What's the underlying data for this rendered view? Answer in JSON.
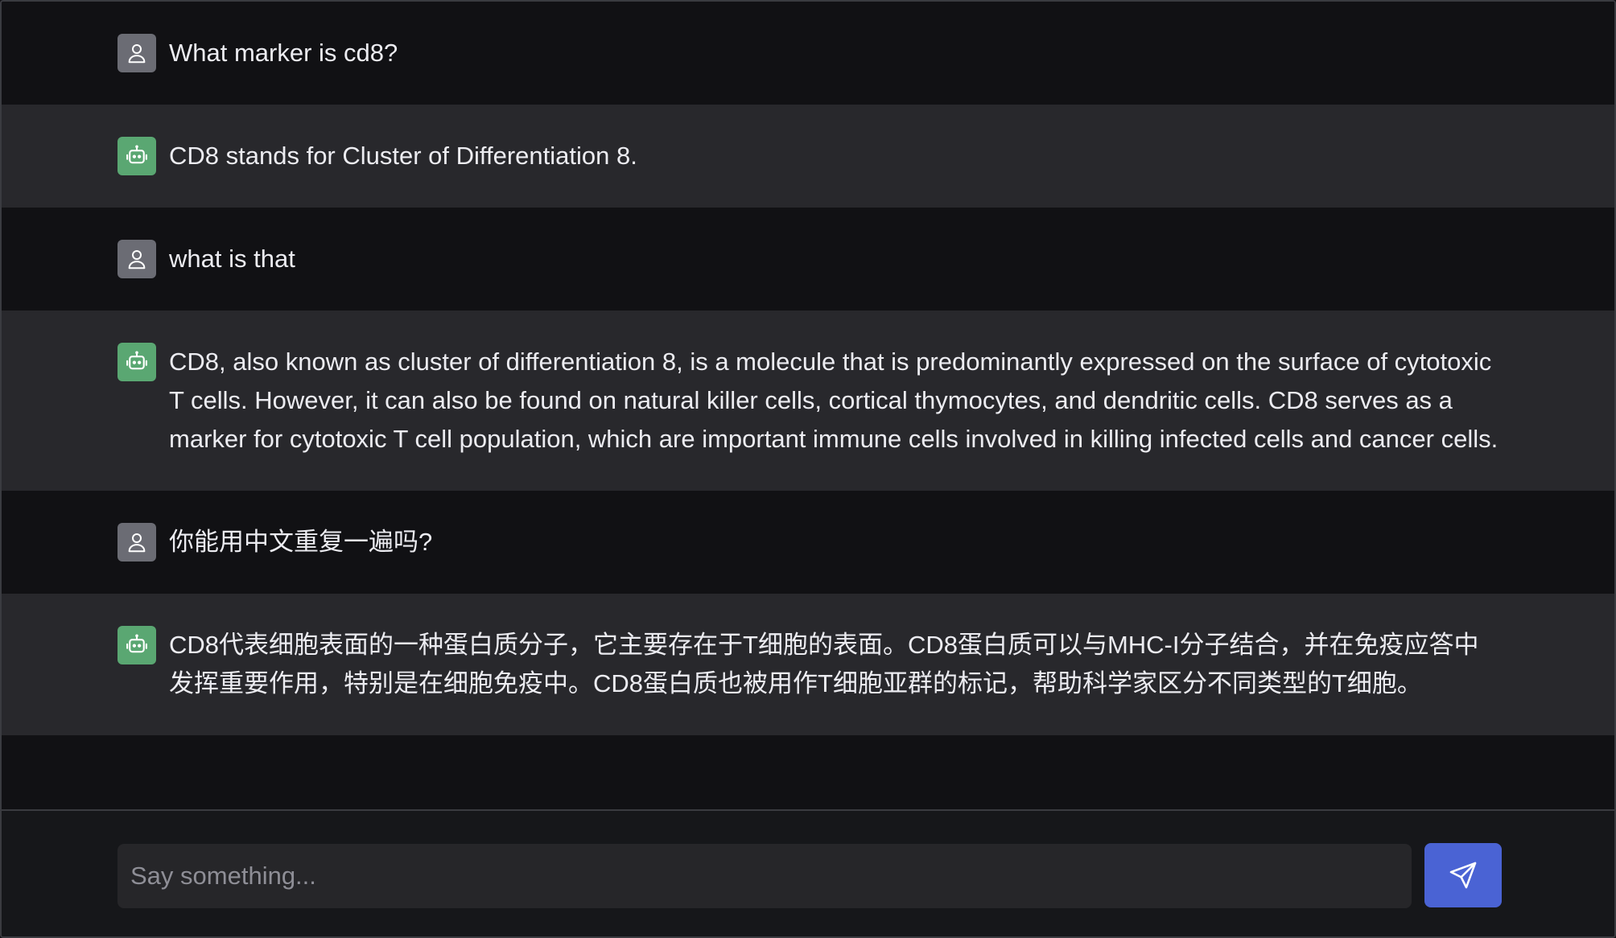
{
  "messages": [
    {
      "role": "user",
      "text": "What marker is cd8?"
    },
    {
      "role": "bot",
      "text": "CD8 stands for Cluster of Differentiation 8."
    },
    {
      "role": "user",
      "text": "what is that"
    },
    {
      "role": "bot",
      "text": "CD8, also known as cluster of differentiation 8, is a molecule that is predominantly expressed on the surface of cytotoxic T cells. However, it can also be found on natural killer cells, cortical thymocytes, and dendritic cells. CD8 serves as a marker for cytotoxic T cell population, which are important immune cells involved in killing infected cells and cancer cells."
    },
    {
      "role": "user",
      "text": "你能用中文重复一遍吗?"
    },
    {
      "role": "bot",
      "text": "CD8代表细胞表面的一种蛋白质分子，它主要存在于T细胞的表面。CD8蛋白质可以与MHC-I分子结合，并在免疫应答中发挥重要作用，特别是在细胞免疫中。CD8蛋白质也被用作T细胞亚群的标记，帮助科学家区分不同类型的T细胞。"
    }
  ],
  "composer": {
    "placeholder": "Say something...",
    "value": "",
    "send_icon": "send-icon"
  },
  "icons": {
    "user_avatar": "user-icon",
    "bot_avatar": "robot-icon"
  },
  "colors": {
    "background": "#111114",
    "bot_row": "#28282c",
    "user_avatar": "#6b6c74",
    "bot_avatar": "#5aa772",
    "send_button": "#4a63d4"
  }
}
